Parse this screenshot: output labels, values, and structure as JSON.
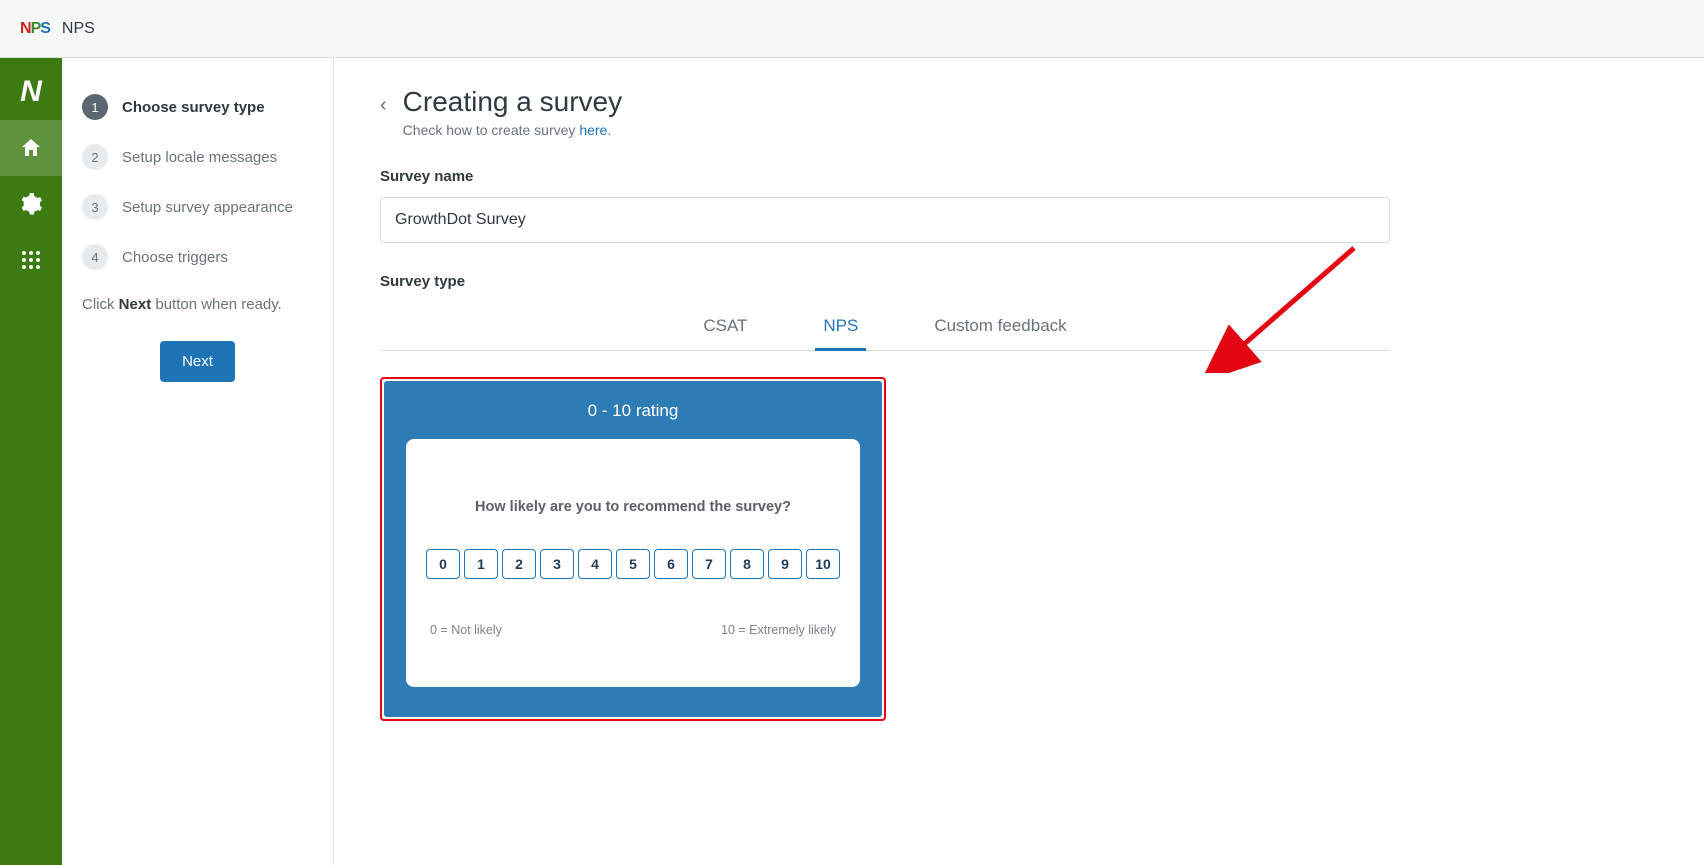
{
  "topbar": {
    "app_name": "NPS"
  },
  "vnav": {
    "items": [
      {
        "name": "brand-n",
        "glyph": "N"
      },
      {
        "name": "home-icon"
      },
      {
        "name": "gear-icon"
      },
      {
        "name": "apps-icon"
      }
    ],
    "active": 1
  },
  "wizard": {
    "steps": [
      {
        "label": "Choose survey type"
      },
      {
        "label": "Setup locale messages"
      },
      {
        "label": "Setup survey appearance"
      },
      {
        "label": "Choose triggers"
      }
    ],
    "active": 0,
    "hint_pre": "Click ",
    "hint_bold": "Next",
    "hint_post": " button when ready.",
    "next_label": "Next"
  },
  "main": {
    "title": "Creating a survey",
    "subtitle_pre": "Check how to create survey ",
    "subtitle_link": "here",
    "subtitle_post": ".",
    "survey_name_label": "Survey name",
    "survey_name_value": "GrowthDot Survey",
    "survey_type_label": "Survey type",
    "tabs": [
      {
        "label": "CSAT"
      },
      {
        "label": "NPS"
      },
      {
        "label": "Custom feedback"
      }
    ],
    "active_tab": 1
  },
  "preview": {
    "caption": "0 - 10 rating",
    "question": "How likely are you to recommend the survey?",
    "ratings": [
      "0",
      "1",
      "2",
      "3",
      "4",
      "5",
      "6",
      "7",
      "8",
      "9",
      "10"
    ],
    "legend_low": "0 = Not likely",
    "legend_high": "10 = Extremely likely"
  }
}
